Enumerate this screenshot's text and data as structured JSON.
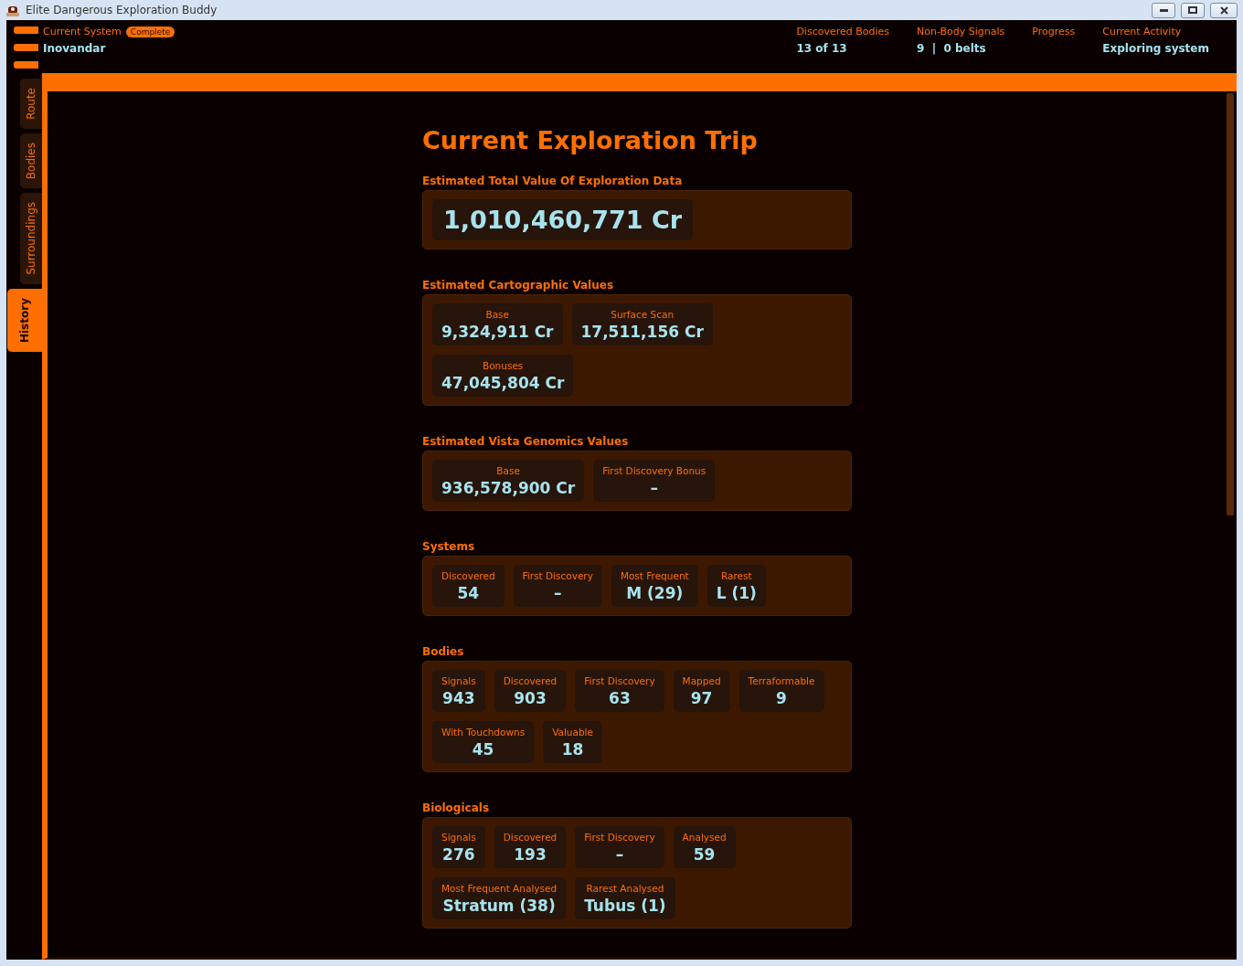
{
  "window": {
    "title": "Elite Dangerous Exploration Buddy"
  },
  "header": {
    "current_system": {
      "label": "Current System",
      "badge": "Complete",
      "value": "Inovandar"
    },
    "stats": [
      {
        "label": "Discovered Bodies",
        "value": "13 of 13"
      },
      {
        "label": "Non-Body Signals",
        "value": "9  |  0 belts"
      },
      {
        "label": "Progress"
      },
      {
        "label": "Current Activity",
        "value": "Exploring system"
      }
    ]
  },
  "tabs": [
    {
      "label": "Route",
      "selected": false
    },
    {
      "label": "Bodies",
      "selected": false
    },
    {
      "label": "Surroundings",
      "selected": false
    },
    {
      "label": "History",
      "selected": true
    }
  ],
  "page": {
    "title": "Current Exploration Trip",
    "sections": [
      {
        "title": "Estimated Total Value Of Exploration Data",
        "kind": "total",
        "items": [
          {
            "value": "1,010,460,771 Cr"
          }
        ]
      },
      {
        "title": "Estimated Cartographic Values",
        "kind": "grid",
        "items": [
          {
            "label": "Base",
            "value": "9,324,911 Cr"
          },
          {
            "label": "Surface Scan",
            "value": "17,511,156 Cr"
          },
          {
            "label": "Bonuses",
            "value": "47,045,804 Cr"
          }
        ]
      },
      {
        "title": "Estimated Vista Genomics Values",
        "kind": "grid",
        "items": [
          {
            "label": "Base",
            "value": "936,578,900 Cr"
          },
          {
            "label": "First Discovery Bonus",
            "value": "–"
          }
        ]
      },
      {
        "title": "Systems",
        "kind": "grid",
        "items": [
          {
            "label": "Discovered",
            "value": "54"
          },
          {
            "label": "First Discovery",
            "value": "–"
          },
          {
            "label": "Most Frequent",
            "value": "M (29)"
          },
          {
            "label": "Rarest",
            "value": "L (1)"
          }
        ]
      },
      {
        "title": "Bodies",
        "kind": "grid",
        "items": [
          {
            "label": "Signals",
            "value": "943"
          },
          {
            "label": "Discovered",
            "value": "903"
          },
          {
            "label": "First Discovery",
            "value": "63"
          },
          {
            "label": "Mapped",
            "value": "97"
          },
          {
            "label": "Terraformable",
            "value": "9"
          },
          {
            "label": "With Touchdowns",
            "value": "45"
          },
          {
            "label": "Valuable",
            "value": "18"
          }
        ]
      },
      {
        "title": "Biologicals",
        "kind": "grid",
        "items": [
          {
            "label": "Signals",
            "value": "276"
          },
          {
            "label": "Discovered",
            "value": "193"
          },
          {
            "label": "First Discovery",
            "value": "–"
          },
          {
            "label": "Analysed",
            "value": "59"
          },
          {
            "label": "Most Frequent Analysed",
            "value": "Stratum (38)"
          },
          {
            "label": "Rarest Analysed",
            "value": "Tubus (1)"
          }
        ]
      }
    ]
  }
}
